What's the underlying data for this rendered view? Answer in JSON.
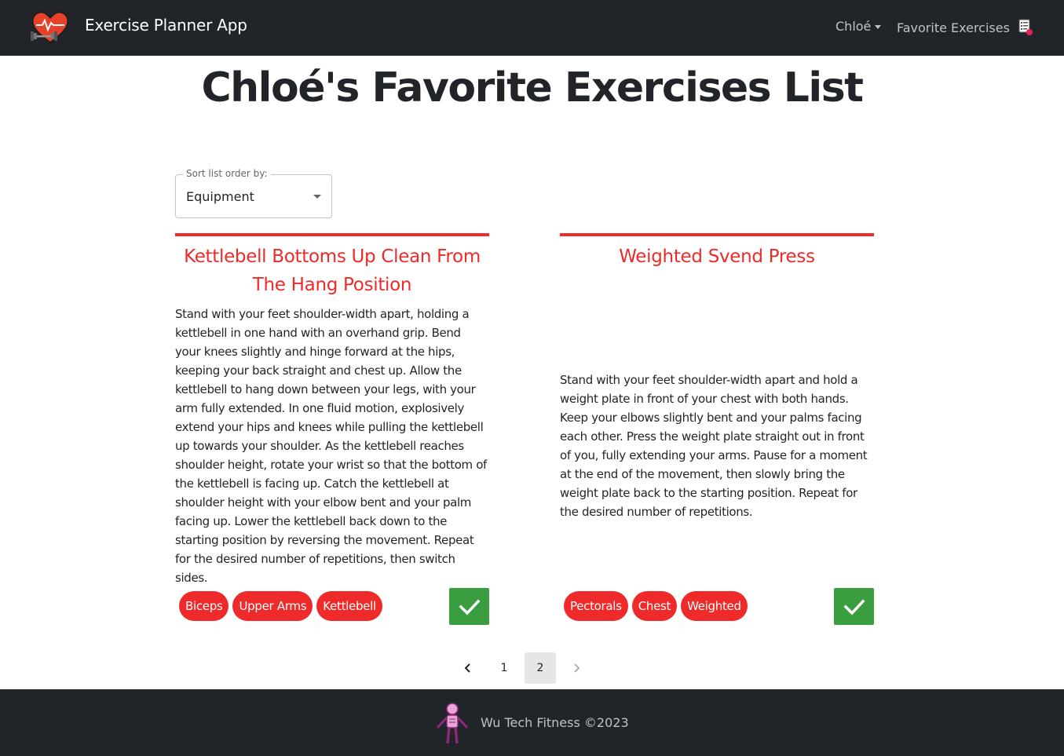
{
  "navbar": {
    "brand": "Exercise Planner App",
    "user": "Chloé",
    "favorites_link": "Favorite Exercises"
  },
  "page": {
    "title": "Chloé's Favorite Exercises List"
  },
  "sort": {
    "label": "Sort list order by:",
    "value": "Equipment"
  },
  "cards": [
    {
      "title": "Kettlebell Bottoms Up Clean From The Hang Position",
      "description": "Stand with your feet shoulder-width apart, holding a kettlebell in one hand with an overhand grip. Bend your knees slightly and hinge forward at the hips, keeping your back straight and chest up. Allow the kettlebell to hang down between your legs, with your arm fully extended. In one fluid motion, explosively extend your hips and knees while pulling the kettlebell up towards your shoulder. As the kettlebell reaches shoulder height, rotate your wrist so that the bottom of the kettlebell is facing up. Catch the kettlebell at shoulder height with your elbow bent and your palm facing up. Lower the kettlebell back down to the starting position by reversing the movement. Repeat for the desired number of repetitions, then switch sides.",
      "tags": [
        "Biceps",
        "Upper Arms",
        "Kettlebell"
      ]
    },
    {
      "title": "Weighted Svend Press",
      "description": "Stand with your feet shoulder-width apart and hold a weight plate in front of your chest with both hands. Keep your elbows slightly bent and your palms facing each other. Press the weight plate straight out in front of you, fully extending your arms. Pause for a moment at the end of the movement, then slowly bring the weight plate back to the starting position. Repeat for the desired number of repetitions.",
      "tags": [
        "Pectorals",
        "Chest",
        "Weighted"
      ]
    }
  ],
  "pagination": {
    "pages": [
      "1",
      "2"
    ],
    "current": "2"
  },
  "footer": {
    "text": "Wu Tech Fitness ©2023"
  },
  "colors": {
    "navbar_bg": "#212529",
    "accent_red": "#ee2a2a",
    "check_green": "#3a9d3f"
  },
  "icons": {
    "brand": "heart-dumbbell-logo-icon",
    "favorites": "list-heart-icon",
    "card_action": "check-icon",
    "pager_prev": "chevron-left-icon",
    "pager_next": "chevron-right-icon",
    "footer": "skeleton-logo-icon"
  }
}
